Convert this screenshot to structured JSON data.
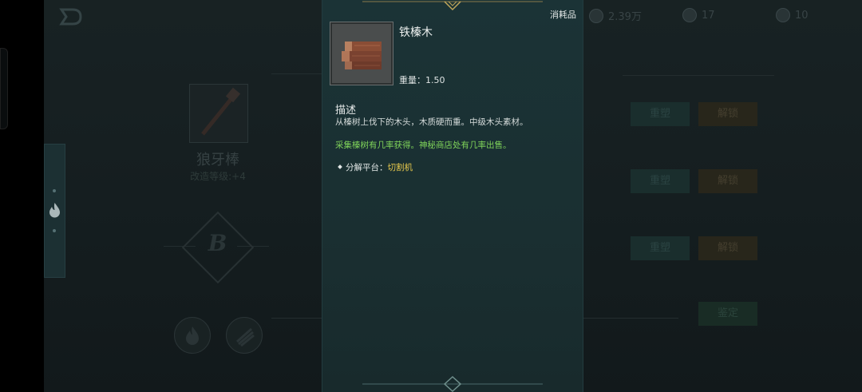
{
  "item": {
    "name": "铁榛木",
    "type": "消耗品",
    "weight_label": "重量：",
    "weight_value": "1.50",
    "desc_title": "描述",
    "desc_text": "从榛树上伐下的木头，木质硬而重。中级木头素材。",
    "acquire_text": "采集榛树有几率获得。神秘商店处有几率出售。",
    "decompose_label": "分解平台：",
    "decompose_value": "切割机"
  },
  "background": {
    "top_resources": [
      "2.39万",
      "17",
      "10"
    ],
    "weapon_name": "狼牙棒",
    "weapon_upgrade": "改造等级:+4",
    "grade": "B",
    "rows": [
      {
        "reshape": "重塑",
        "unlock": "解锁"
      },
      {
        "reshape": "重塑",
        "unlock": "解锁"
      },
      {
        "reshape": "重塑",
        "unlock": "解锁"
      }
    ],
    "appraise": "鉴定"
  },
  "colors": {
    "panel_bg": "#1b3336",
    "acquire_text": "#7fd35a",
    "decompose_value": "#e6c84c"
  }
}
